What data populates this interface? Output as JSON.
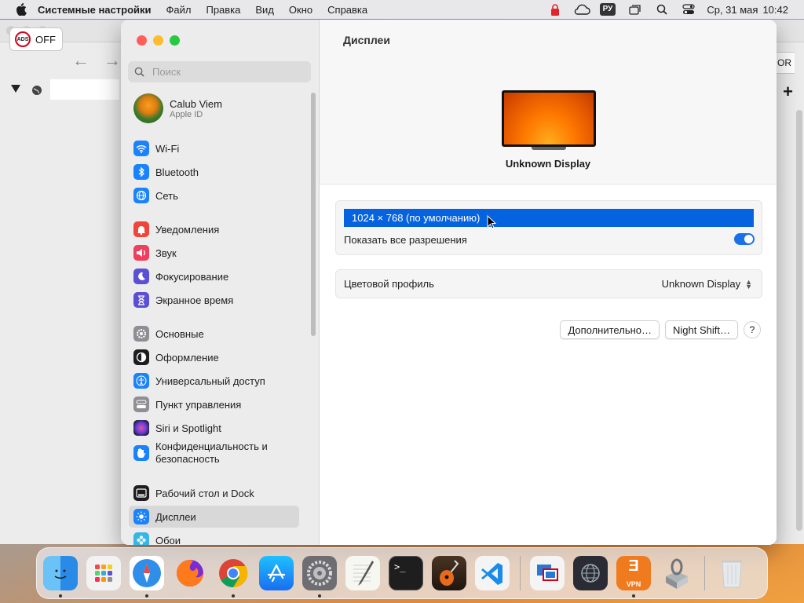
{
  "menubar": {
    "app_name": "Системные настройки",
    "menus": [
      "Файл",
      "Правка",
      "Вид",
      "Окно",
      "Справка"
    ],
    "language": "РУ",
    "date": "Ср, 31 мая",
    "time": "10:42"
  },
  "browser": {
    "ads_label": "OFF",
    "ads_badge": "ADS",
    "right_btn": "OR"
  },
  "settings": {
    "search_placeholder": "Поиск",
    "user": {
      "name": "Calub Viem",
      "subtitle": "Apple ID"
    },
    "sidebar": [
      {
        "label": "Wi-Fi",
        "icon": "wifi-icon",
        "color": "#1a82fb"
      },
      {
        "label": "Bluetooth",
        "icon": "bluetooth-icon",
        "color": "#1a82fb"
      },
      {
        "label": "Сеть",
        "icon": "globe-icon",
        "color": "#1a82fb"
      },
      {
        "label": "Уведомления",
        "icon": "bell-icon",
        "color": "#f0453a"
      },
      {
        "label": "Звук",
        "icon": "speaker-icon",
        "color": "#ee3f5c"
      },
      {
        "label": "Фокусирование",
        "icon": "moon-icon",
        "color": "#5b4fd6"
      },
      {
        "label": "Экранное время",
        "icon": "hourglass-icon",
        "color": "#5b4fd6"
      },
      {
        "label": "Основные",
        "icon": "gear-icon",
        "color": "#8e8e93"
      },
      {
        "label": "Оформление",
        "icon": "appearance-icon",
        "color": "#1d1d1f"
      },
      {
        "label": "Универсальный доступ",
        "icon": "accessibility-icon",
        "color": "#1a82fb"
      },
      {
        "label": "Пункт управления",
        "icon": "control-center-icon",
        "color": "#8e8e93"
      },
      {
        "label": "Siri и Spotlight",
        "icon": "siri-icon",
        "color": "#3c2d8a"
      },
      {
        "label": "Конфиденциальность и безопасность",
        "icon": "hand-icon",
        "color": "#1a82fb"
      },
      {
        "label": "Рабочий стол и Dock",
        "icon": "dock-icon",
        "color": "#1d1d1f"
      },
      {
        "label": "Дисплеи",
        "icon": "sun-icon",
        "color": "#1a82fb"
      },
      {
        "label": "Обои",
        "icon": "flower-icon",
        "color": "#36b5e8"
      }
    ],
    "main": {
      "title": "Дисплеи",
      "display_name": "Unknown Display",
      "resolution": "1024 × 768 (по умолчанию)",
      "show_all_label": "Показать все разрешения",
      "show_all_on": true,
      "color_profile_label": "Цветовой профиль",
      "color_profile_value": "Unknown Display",
      "advanced_button": "Дополнительно…",
      "night_shift_button": "Night Shift…",
      "help_button": "?"
    }
  },
  "dock": [
    {
      "name": "finder-icon",
      "color": "#3aa0f0",
      "running": true
    },
    {
      "name": "launchpad-icon",
      "color": "#f2f2f2",
      "running": false
    },
    {
      "name": "safari-icon",
      "color": "#2f8fe8",
      "running": true
    },
    {
      "name": "firefox-icon",
      "color": "#7b2bd6",
      "running": false
    },
    {
      "name": "chrome-icon",
      "color": "#f2f2f2",
      "running": true
    },
    {
      "name": "app-store-icon",
      "color": "#1a8cf0",
      "running": false
    },
    {
      "name": "system-settings-icon",
      "color": "#777777",
      "running": true
    },
    {
      "name": "textedit-icon",
      "color": "#f4f4f4",
      "running": false
    },
    {
      "name": "terminal-icon",
      "color": "#1e1e1e",
      "running": false
    },
    {
      "name": "garageband-icon",
      "color": "#3a2a1a",
      "running": false
    },
    {
      "name": "vscode-icon",
      "color": "#f4f4f4",
      "running": false
    },
    {
      "name": "parallels-icon",
      "color": "#f4f4f4",
      "running": false
    },
    {
      "name": "network-icon",
      "color": "#2b2b35",
      "running": false
    },
    {
      "name": "vpn-icon",
      "color": "#f07a1e",
      "running": true
    },
    {
      "name": "installer-icon",
      "color": "#cfd2d6",
      "running": false
    },
    {
      "name": "trash-icon",
      "color": "#e8eaec",
      "running": false
    }
  ],
  "dock_vpn_label": "VPN"
}
